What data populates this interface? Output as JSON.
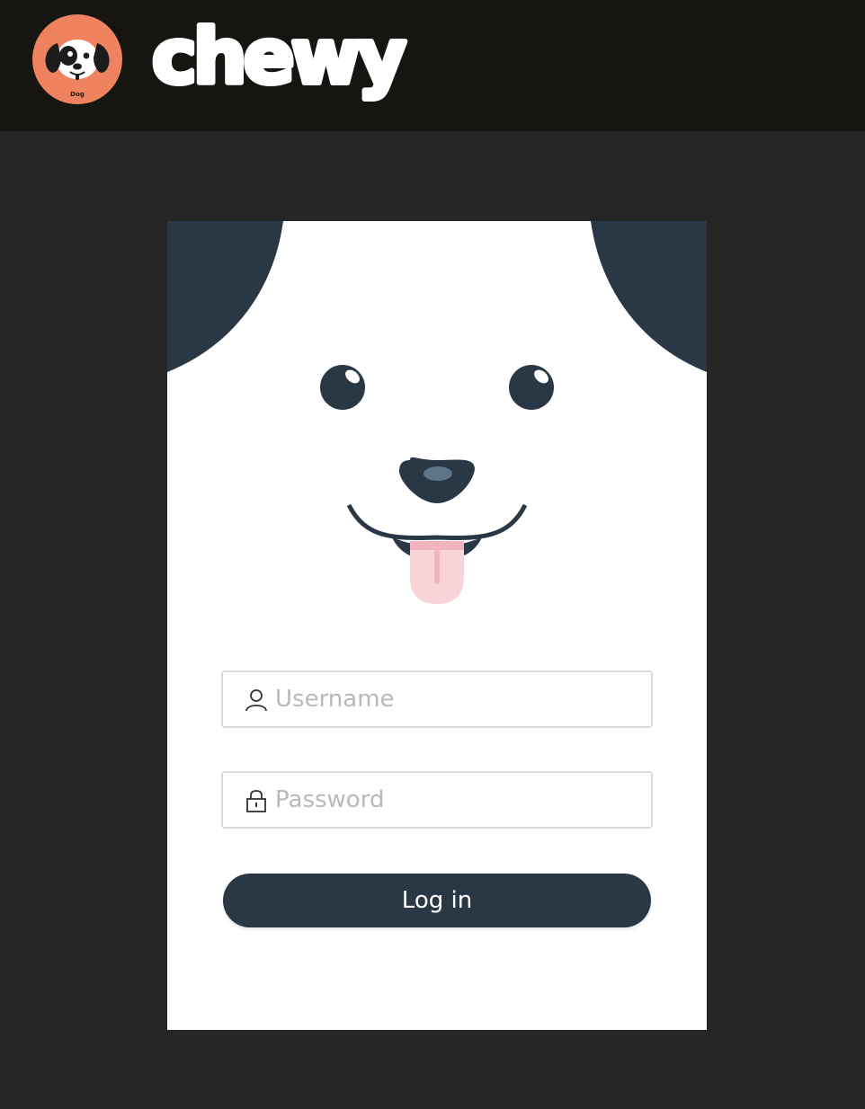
{
  "header": {
    "logo": {
      "icon": "dog-face-icon",
      "badge_text": "Dog",
      "badge_color": "#F0835F"
    },
    "wordmark": "chewy",
    "background": "#161511"
  },
  "login_card": {
    "illustration": "puppy-face",
    "username": {
      "placeholder": "Username",
      "value": "",
      "icon": "user-icon"
    },
    "password": {
      "placeholder": "Password",
      "value": "",
      "icon": "lock-icon"
    },
    "submit_label": "Log in"
  },
  "colors": {
    "navy": "#2A3846",
    "tongue": "#F8D3D8",
    "page_background": "#262626"
  }
}
